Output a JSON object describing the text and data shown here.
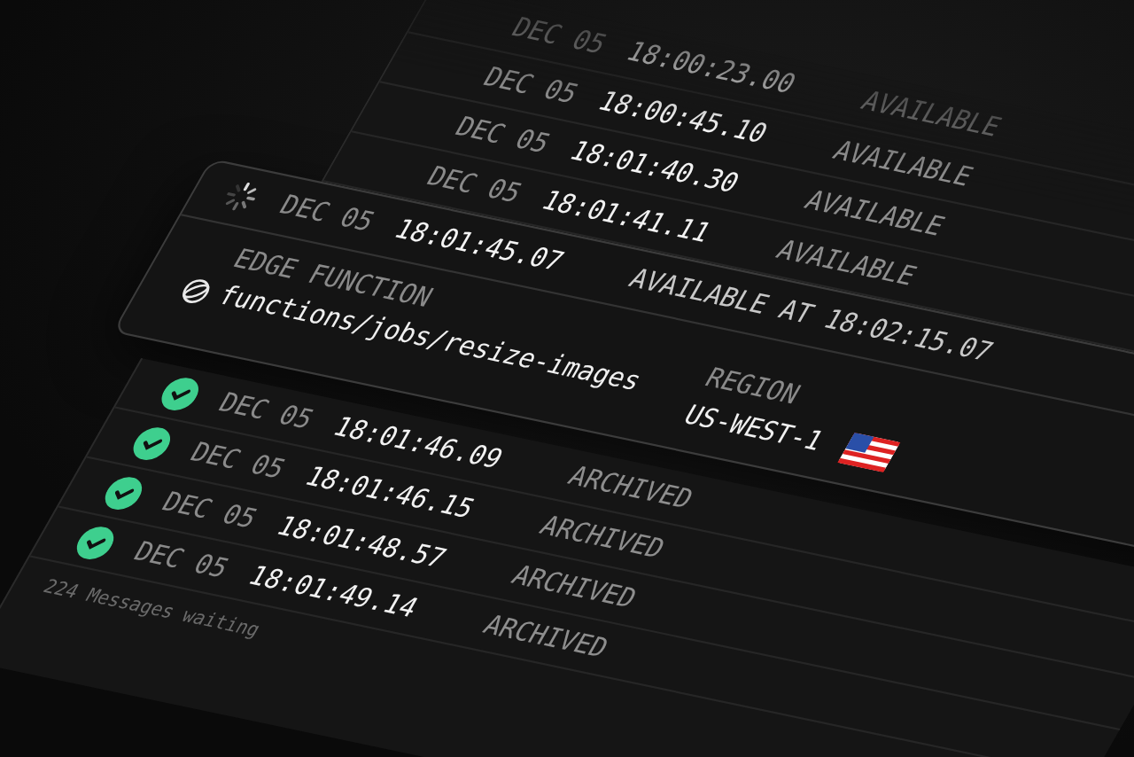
{
  "queue_rows": [
    {
      "kind": "available",
      "date": "DEC 05",
      "time": "18:00:23.00",
      "status": "AVAILABLE"
    },
    {
      "kind": "available",
      "date": "DEC 05",
      "time": "18:00:45.10",
      "status": "AVAILABLE"
    },
    {
      "kind": "available",
      "date": "DEC 05",
      "time": "18:01:40.30",
      "status": "AVAILABLE"
    },
    {
      "kind": "available",
      "date": "DEC 05",
      "time": "18:01:41.11",
      "status": "AVAILABLE"
    }
  ],
  "selected_message": {
    "date": "DEC 05",
    "time": "18:01:45.07",
    "status": "AVAILABLE AT 18:02:15.07",
    "function_label": "EDGE FUNCTION",
    "function_path": "functions/jobs/resize-images",
    "region_label": "REGION",
    "region": "US-WEST-1"
  },
  "archived_rows": [
    {
      "kind": "archived",
      "date": "DEC 05",
      "time": "18:01:46.09",
      "status": "ARCHIVED"
    },
    {
      "kind": "archived",
      "date": "DEC 05",
      "time": "18:01:46.15",
      "status": "ARCHIVED"
    },
    {
      "kind": "archived",
      "date": "DEC 05",
      "time": "18:01:48.57",
      "status": "ARCHIVED"
    },
    {
      "kind": "archived",
      "date": "DEC 05",
      "time": "18:01:49.14",
      "status": "ARCHIVED"
    }
  ],
  "footer": "224 Messages waiting"
}
